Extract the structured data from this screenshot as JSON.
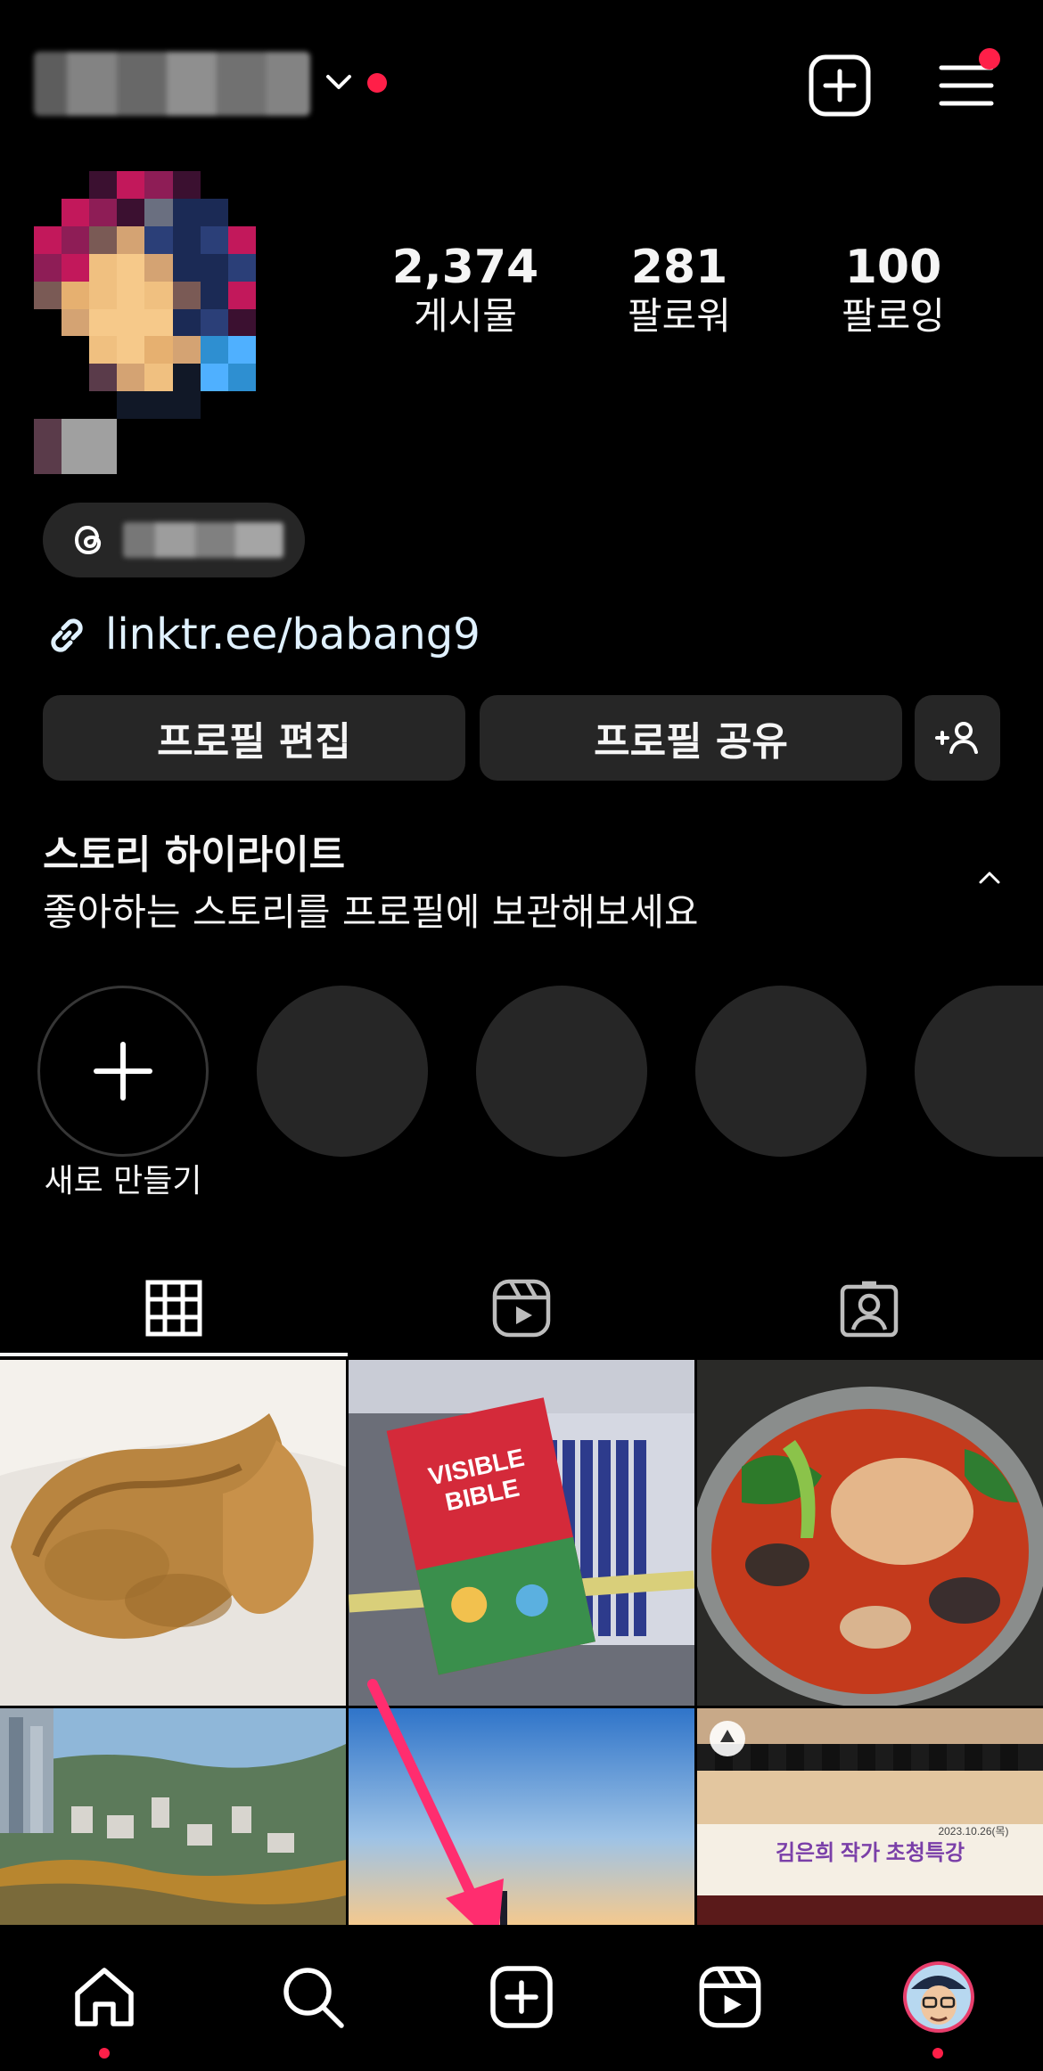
{
  "header": {
    "username_blurred": true
  },
  "profile": {
    "stats": [
      {
        "value": "2,374",
        "label": "게시물"
      },
      {
        "value": "281",
        "label": "팔로워"
      },
      {
        "value": "100",
        "label": "팔로잉"
      }
    ],
    "link": "linktr.ee/babang9"
  },
  "actions": {
    "edit_label": "프로필 편집",
    "share_label": "프로필 공유"
  },
  "highlights": {
    "title": "스토리 하이라이트",
    "subtitle": "좋아하는 스토리를 프로필에 보관해보세요",
    "new_label": "새로 만들기"
  },
  "tabs": [
    {
      "icon": "grid-icon",
      "active": true
    },
    {
      "icon": "reels-icon",
      "active": false
    },
    {
      "icon": "tagged-icon",
      "active": false
    }
  ],
  "posts": [
    {
      "caption": "",
      "text_lines": []
    },
    {
      "caption": "",
      "text_lines": [
        "VISIBLE",
        "BIBLE"
      ]
    },
    {
      "caption": "",
      "text_lines": []
    },
    {
      "caption": "",
      "text_lines": []
    },
    {
      "caption": "",
      "text_lines": []
    },
    {
      "caption": "",
      "text_lines": [
        "김은희 작가 초청특강",
        "2023.10.26(목)"
      ]
    }
  ],
  "bottom_nav": [
    {
      "icon": "home-icon"
    },
    {
      "icon": "search-icon"
    },
    {
      "icon": "create-icon"
    },
    {
      "icon": "reels-icon"
    },
    {
      "icon": "profile-avatar"
    }
  ],
  "colors": {
    "background": "#000000",
    "surface": "#262626",
    "notification": "#ff1f48",
    "link": "#e0f1ff",
    "annotation_arrow": "#ff2d6f"
  }
}
